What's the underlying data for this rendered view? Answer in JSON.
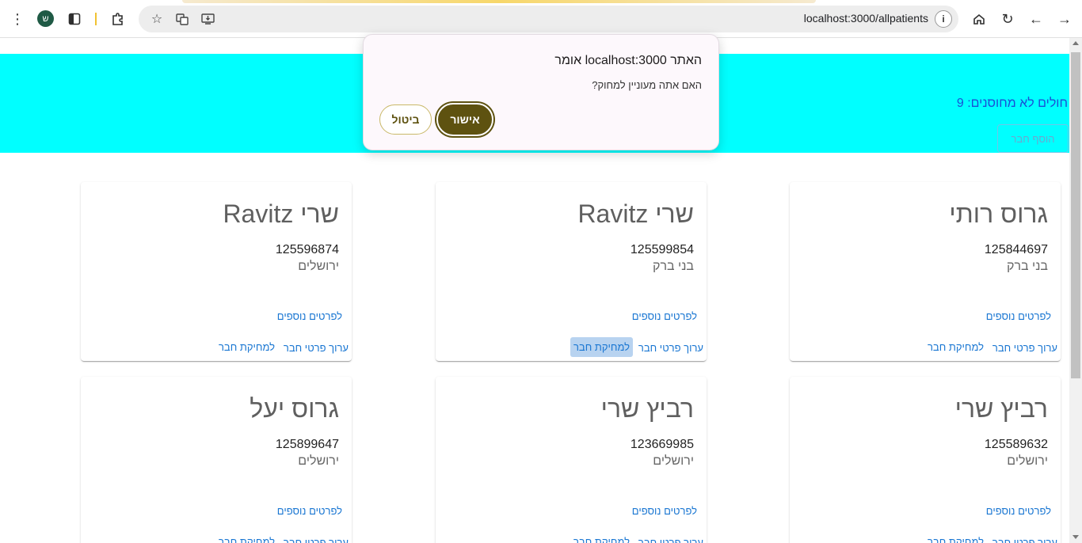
{
  "browser": {
    "url": "localhost:3000/allpatients",
    "profile_initial": "ש"
  },
  "header": {
    "count_text": "חולים לא מחוסנים: 9",
    "add_button_label": "הוסף חבר",
    "background_color": "#00ffff"
  },
  "cards": [
    {
      "name": "גרוס רותי",
      "id": "125844697",
      "city": "בני ברק",
      "more": "לפרטים נוספים",
      "edit": "ערוך פרטי חבר",
      "delete": "למחיקת חבר"
    },
    {
      "name": "שרי Ravitz",
      "id": "125599854",
      "city": "בני ברק",
      "more": "לפרטים נוספים",
      "edit": "ערוך פרטי חבר",
      "delete": "למחיקת חבר"
    },
    {
      "name": "שרי Ravitz",
      "id": "125596874",
      "city": "ירושלים",
      "more": "לפרטים נוספים",
      "edit": "ערוך פרטי חבר",
      "delete": "למחיקת חבר"
    },
    {
      "name": "רביץ שרי",
      "id": "125589632",
      "city": "ירושלים",
      "more": "לפרטים נוספים",
      "edit": "ערוך פרטי חבר",
      "delete": "למחיקת חבר"
    },
    {
      "name": "רביץ שרי",
      "id": "123669985",
      "city": "ירושלים",
      "more": "לפרטים נוספים",
      "edit": "ערוך פרטי חבר",
      "delete": "למחיקת חבר"
    },
    {
      "name": "גרוס יעל",
      "id": "125899647",
      "city": "ירושלים",
      "more": "לפרטים נוספים",
      "edit": "ערוך פרטי חבר",
      "delete": "למחיקת חבר"
    }
  ],
  "dialog": {
    "title": "האתר localhost:3000 אומר",
    "message": "האם אתה מעוניין למחוק?",
    "ok_label": "אישור",
    "cancel_label": "ביטול"
  }
}
